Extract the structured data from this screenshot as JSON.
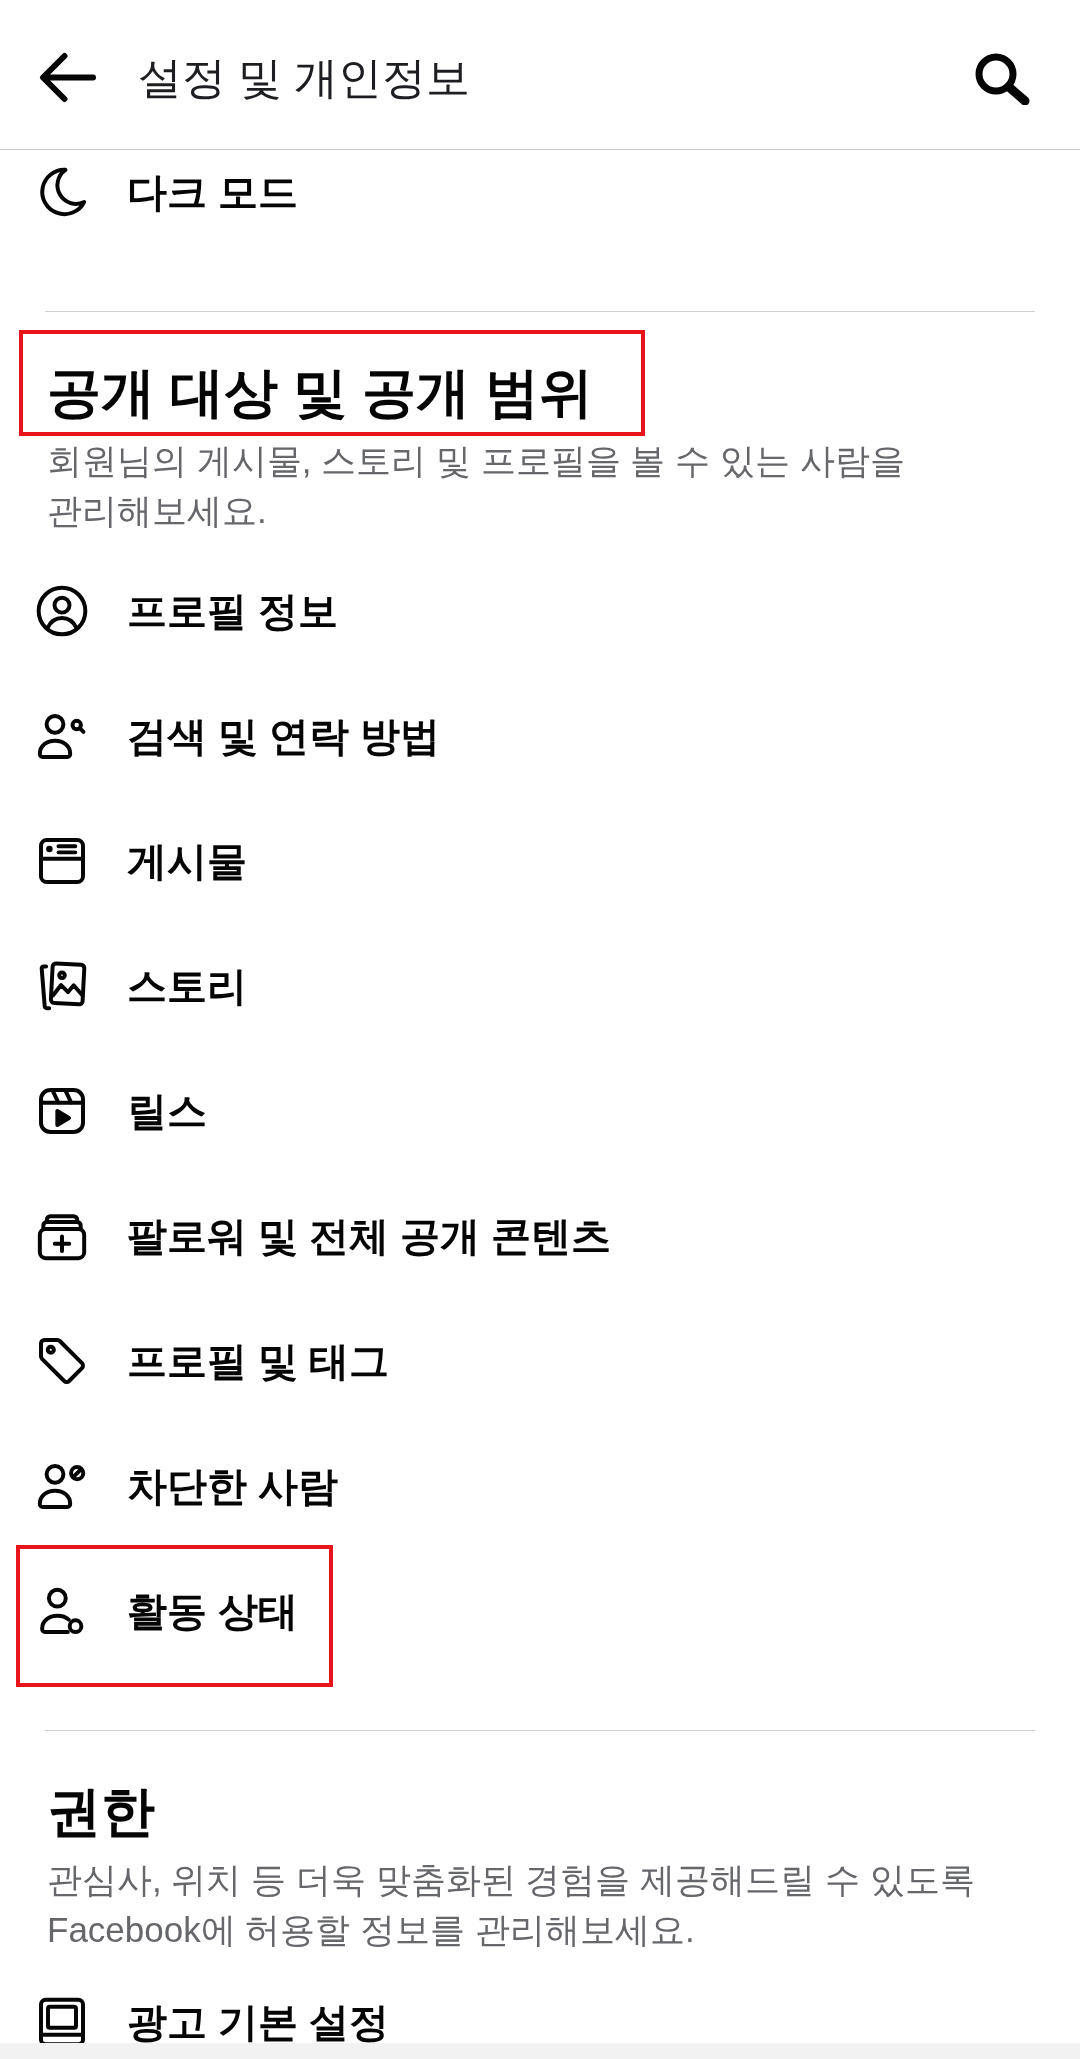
{
  "header": {
    "title": "설정 및 개인정보"
  },
  "sections": [
    {
      "items": [
        {
          "kind": "theme",
          "label": "다크 모드",
          "highlighted": false
        }
      ]
    },
    {
      "title": "공개 대상 및 공개 범위",
      "highlighted": true,
      "description": "회원님의 게시물, 스토리 및 프로필을 볼 수 있는 사람을 관리해보세요.",
      "items": [
        {
          "kind": "profile",
          "label": "프로필 정보",
          "highlighted": false
        },
        {
          "kind": "discoverability",
          "label": "검색 및 연락 방법",
          "highlighted": false
        },
        {
          "kind": "posts",
          "label": "게시물",
          "highlighted": false
        },
        {
          "kind": "stories",
          "label": "스토리",
          "highlighted": false
        },
        {
          "kind": "reels",
          "label": "릴스",
          "highlighted": false
        },
        {
          "kind": "followers",
          "label": "팔로워 및 전체 공개 콘텐츠",
          "highlighted": false
        },
        {
          "kind": "tagging",
          "label": "프로필 및 태그",
          "highlighted": false
        },
        {
          "kind": "blocking",
          "label": "차단한 사람",
          "highlighted": false
        },
        {
          "kind": "activity",
          "label": "활동 상태",
          "highlighted": true
        }
      ]
    },
    {
      "title": "권한",
      "highlighted": false,
      "description": "관심사, 위치 등 더욱 맞춤화된 경험을 제공해드릴 수 있도록 Facebook에 허용할 정보를 관리해보세요.",
      "items": [
        {
          "kind": "ads",
          "label": "광고 기본 설정",
          "highlighted": false
        }
      ]
    }
  ]
}
